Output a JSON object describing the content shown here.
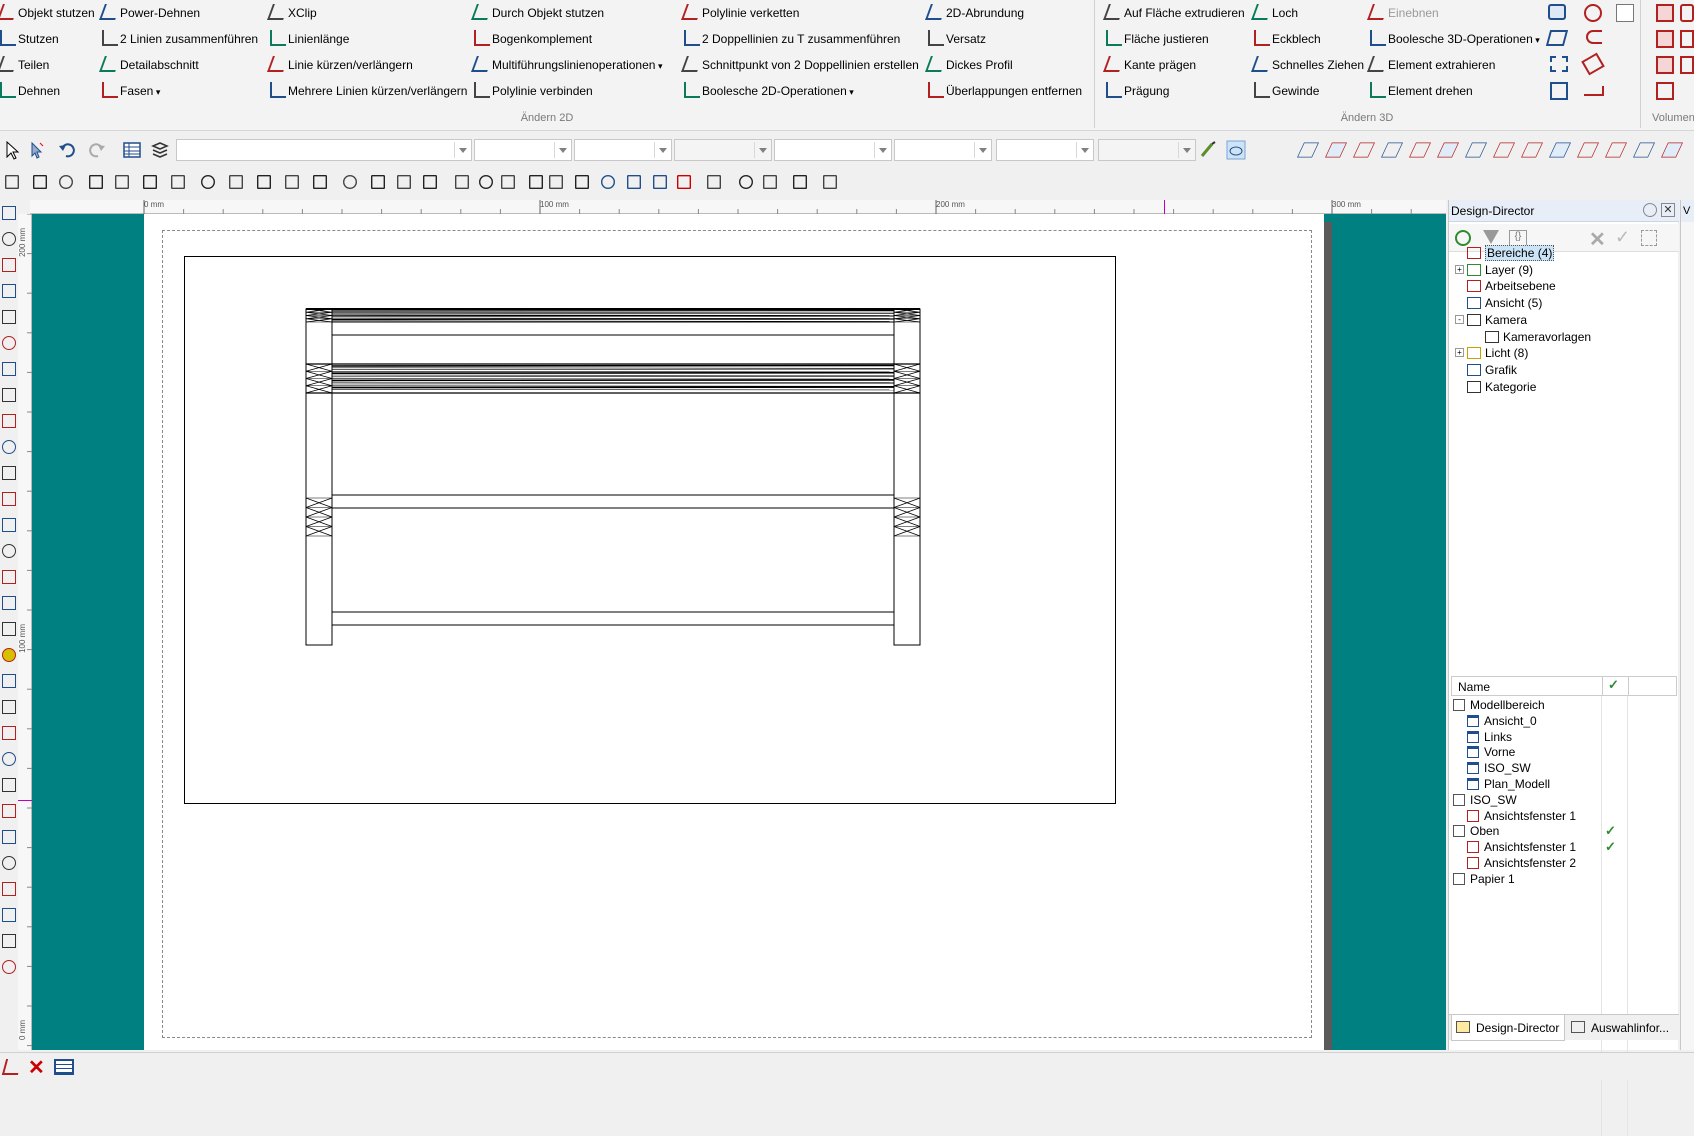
{
  "ribbon": {
    "col1": [
      "Objekt stutzen",
      "Stutzen",
      "Teilen",
      "Dehnen"
    ],
    "col2": [
      "Power-Dehnen",
      "2 Linien zusammenführen",
      "Detailabschnitt",
      "Fasen"
    ],
    "col3": [
      "XClip",
      "Linienlänge",
      "Linie kürzen/verlängern",
      "Mehrere Linien kürzen/verlängern"
    ],
    "col4": [
      "Durch Objekt stutzen",
      "Bogenkomplement",
      "Multiführungslinienoperationen",
      "Polylinie verbinden"
    ],
    "col5": [
      "Polylinie verketten",
      "2 Doppellinien zu T zusammenführen",
      "Schnittpunkt von 2 Doppellinien erstellen",
      "Boolesche 2D-Operationen"
    ],
    "col6": [
      "2D-Abrundung",
      "Versatz",
      "Dickes Profil",
      "Überlappungen entfernen"
    ],
    "col7": [
      "Auf Fläche extrudieren",
      "Fläche justieren",
      "Kante prägen",
      "Prägung"
    ],
    "col8": [
      "Loch",
      "Eckblech",
      "Schnelles Ziehen",
      "Gewinde"
    ],
    "col9": [
      "Einebnen",
      "Boolesche 3D-Operationen",
      "Element extrahieren",
      "Element drehen"
    ],
    "group_2d": "Ändern 2D",
    "group_3d": "Ändern 3D",
    "group_vol": "Volumen"
  },
  "ruler": {
    "labels": [
      "0 mm",
      "100 mm",
      "200 mm",
      "300 mm"
    ],
    "vlabels": [
      "200 mm",
      "100 mm",
      "0 mm"
    ]
  },
  "panel": {
    "title": "Design-Director",
    "tree": [
      {
        "label": "Bereiche (4)",
        "icon": "area-icon",
        "selected": true
      },
      {
        "label": "Layer (9)",
        "icon": "layer-icon"
      },
      {
        "label": "Arbeitsebene",
        "icon": "workplane-icon"
      },
      {
        "label": "Ansicht (5)",
        "icon": "view-icon"
      },
      {
        "label": "Kamera",
        "icon": "camera-icon"
      },
      {
        "label": "Kameravorlagen",
        "icon": "camera-template-icon"
      },
      {
        "label": "Licht (8)",
        "icon": "light-icon"
      },
      {
        "label": "Grafik",
        "icon": "graphic-icon"
      },
      {
        "label": "Kategorie",
        "icon": "category-icon"
      }
    ],
    "list_header": "Name",
    "list": [
      {
        "label": "Modellbereich",
        "level": 0,
        "icon": "modelspace-icon",
        "check": false
      },
      {
        "label": "Ansicht_0",
        "level": 1,
        "icon": "view-icon",
        "check": false
      },
      {
        "label": "Links",
        "level": 1,
        "icon": "view-icon",
        "check": false
      },
      {
        "label": "Vorne",
        "level": 1,
        "icon": "view-icon",
        "check": false
      },
      {
        "label": "ISO_SW",
        "level": 1,
        "icon": "view-icon",
        "check": false
      },
      {
        "label": "Plan_Modell",
        "level": 1,
        "icon": "view-icon",
        "check": false
      },
      {
        "label": "ISO_SW",
        "level": 0,
        "icon": "paper-icon",
        "check": false
      },
      {
        "label": "Ansichtsfenster 1",
        "level": 1,
        "icon": "viewport-icon",
        "check": false
      },
      {
        "label": "Oben",
        "level": 0,
        "icon": "paper-icon",
        "check": true
      },
      {
        "label": "Ansichtsfenster 1",
        "level": 1,
        "icon": "viewport-icon",
        "check": true
      },
      {
        "label": "Ansichtsfenster 2",
        "level": 1,
        "icon": "viewport-icon",
        "check": false
      },
      {
        "label": "Papier 1",
        "level": 0,
        "icon": "paper-icon",
        "check": false
      }
    ],
    "tabs": [
      "Design-Director",
      "Auswahlinfor..."
    ]
  },
  "colors": {
    "teal": "#008080",
    "accent": "#0078d7"
  }
}
